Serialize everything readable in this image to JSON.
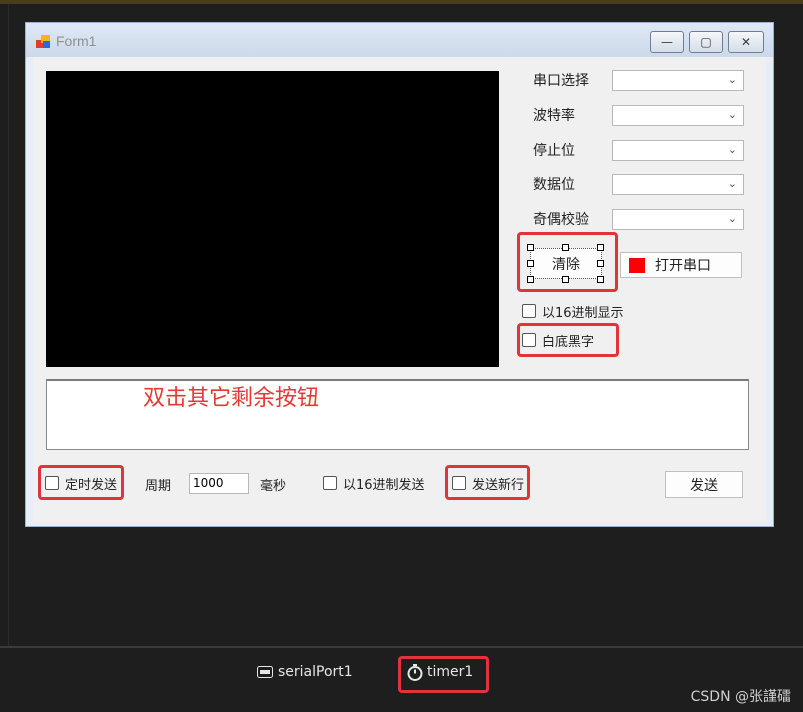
{
  "window": {
    "title": "Form1",
    "minimize_label": "—",
    "maximize_label": "▢",
    "close_label": "✕"
  },
  "serial_settings": {
    "port_label": "串口选择",
    "baud_label": "波特率",
    "stop_bits_label": "停止位",
    "data_bits_label": "数据位",
    "parity_label": "奇偶校验"
  },
  "buttons": {
    "clear_label": "清除",
    "open_port_label": "打开串口",
    "send_label": "发送",
    "port_status_color": "#ff0000"
  },
  "checkboxes": {
    "hex_display_label": "以16进制显示",
    "white_bg_black_text_label": "白底黑字",
    "timed_send_label": "定时发送",
    "hex_send_label": "以16进制发送",
    "send_newline_label": "发送新行"
  },
  "timing": {
    "period_label": "周期",
    "period_value": "1000",
    "unit_label": "毫秒"
  },
  "annotation": "双击其它剩余按钮",
  "tray": {
    "serial_port": "serialPort1",
    "timer": "timer1"
  },
  "watermark": "CSDN @张謹礌"
}
